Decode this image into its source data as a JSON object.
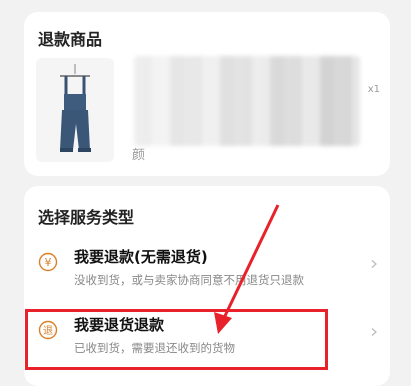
{
  "product_card": {
    "title": "退款商品",
    "quantity": "x1",
    "spec_prefix": "颜"
  },
  "service_card": {
    "title": "选择服务类型",
    "options": [
      {
        "icon": "yuan-refund-icon",
        "icon_char": "¥",
        "title": "我要退款(无需退货)",
        "description": "没收到货，或与卖家协商同意不用退货只退款"
      },
      {
        "icon": "return-icon",
        "icon_char": "退",
        "title": "我要退货退款",
        "description": "已收到货，需要退还收到的货物"
      }
    ]
  },
  "colors": {
    "accent": "#e8212a",
    "icon_orange": "#d9822b"
  }
}
